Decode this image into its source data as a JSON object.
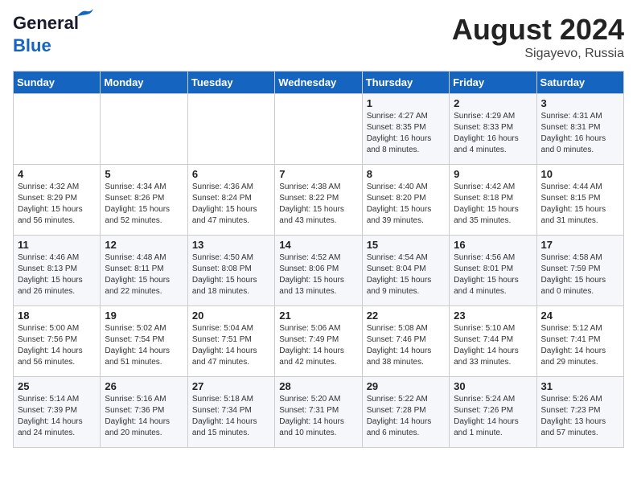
{
  "header": {
    "logo_line1": "General",
    "logo_line2": "Blue",
    "month_year": "August 2024",
    "location": "Sigayevo, Russia"
  },
  "days_of_week": [
    "Sunday",
    "Monday",
    "Tuesday",
    "Wednesday",
    "Thursday",
    "Friday",
    "Saturday"
  ],
  "weeks": [
    [
      {
        "day": "",
        "info": ""
      },
      {
        "day": "",
        "info": ""
      },
      {
        "day": "",
        "info": ""
      },
      {
        "day": "",
        "info": ""
      },
      {
        "day": "1",
        "info": "Sunrise: 4:27 AM\nSunset: 8:35 PM\nDaylight: 16 hours\nand 8 minutes."
      },
      {
        "day": "2",
        "info": "Sunrise: 4:29 AM\nSunset: 8:33 PM\nDaylight: 16 hours\nand 4 minutes."
      },
      {
        "day": "3",
        "info": "Sunrise: 4:31 AM\nSunset: 8:31 PM\nDaylight: 16 hours\nand 0 minutes."
      }
    ],
    [
      {
        "day": "4",
        "info": "Sunrise: 4:32 AM\nSunset: 8:29 PM\nDaylight: 15 hours\nand 56 minutes."
      },
      {
        "day": "5",
        "info": "Sunrise: 4:34 AM\nSunset: 8:26 PM\nDaylight: 15 hours\nand 52 minutes."
      },
      {
        "day": "6",
        "info": "Sunrise: 4:36 AM\nSunset: 8:24 PM\nDaylight: 15 hours\nand 47 minutes."
      },
      {
        "day": "7",
        "info": "Sunrise: 4:38 AM\nSunset: 8:22 PM\nDaylight: 15 hours\nand 43 minutes."
      },
      {
        "day": "8",
        "info": "Sunrise: 4:40 AM\nSunset: 8:20 PM\nDaylight: 15 hours\nand 39 minutes."
      },
      {
        "day": "9",
        "info": "Sunrise: 4:42 AM\nSunset: 8:18 PM\nDaylight: 15 hours\nand 35 minutes."
      },
      {
        "day": "10",
        "info": "Sunrise: 4:44 AM\nSunset: 8:15 PM\nDaylight: 15 hours\nand 31 minutes."
      }
    ],
    [
      {
        "day": "11",
        "info": "Sunrise: 4:46 AM\nSunset: 8:13 PM\nDaylight: 15 hours\nand 26 minutes."
      },
      {
        "day": "12",
        "info": "Sunrise: 4:48 AM\nSunset: 8:11 PM\nDaylight: 15 hours\nand 22 minutes."
      },
      {
        "day": "13",
        "info": "Sunrise: 4:50 AM\nSunset: 8:08 PM\nDaylight: 15 hours\nand 18 minutes."
      },
      {
        "day": "14",
        "info": "Sunrise: 4:52 AM\nSunset: 8:06 PM\nDaylight: 15 hours\nand 13 minutes."
      },
      {
        "day": "15",
        "info": "Sunrise: 4:54 AM\nSunset: 8:04 PM\nDaylight: 15 hours\nand 9 minutes."
      },
      {
        "day": "16",
        "info": "Sunrise: 4:56 AM\nSunset: 8:01 PM\nDaylight: 15 hours\nand 4 minutes."
      },
      {
        "day": "17",
        "info": "Sunrise: 4:58 AM\nSunset: 7:59 PM\nDaylight: 15 hours\nand 0 minutes."
      }
    ],
    [
      {
        "day": "18",
        "info": "Sunrise: 5:00 AM\nSunset: 7:56 PM\nDaylight: 14 hours\nand 56 minutes."
      },
      {
        "day": "19",
        "info": "Sunrise: 5:02 AM\nSunset: 7:54 PM\nDaylight: 14 hours\nand 51 minutes."
      },
      {
        "day": "20",
        "info": "Sunrise: 5:04 AM\nSunset: 7:51 PM\nDaylight: 14 hours\nand 47 minutes."
      },
      {
        "day": "21",
        "info": "Sunrise: 5:06 AM\nSunset: 7:49 PM\nDaylight: 14 hours\nand 42 minutes."
      },
      {
        "day": "22",
        "info": "Sunrise: 5:08 AM\nSunset: 7:46 PM\nDaylight: 14 hours\nand 38 minutes."
      },
      {
        "day": "23",
        "info": "Sunrise: 5:10 AM\nSunset: 7:44 PM\nDaylight: 14 hours\nand 33 minutes."
      },
      {
        "day": "24",
        "info": "Sunrise: 5:12 AM\nSunset: 7:41 PM\nDaylight: 14 hours\nand 29 minutes."
      }
    ],
    [
      {
        "day": "25",
        "info": "Sunrise: 5:14 AM\nSunset: 7:39 PM\nDaylight: 14 hours\nand 24 minutes."
      },
      {
        "day": "26",
        "info": "Sunrise: 5:16 AM\nSunset: 7:36 PM\nDaylight: 14 hours\nand 20 minutes."
      },
      {
        "day": "27",
        "info": "Sunrise: 5:18 AM\nSunset: 7:34 PM\nDaylight: 14 hours\nand 15 minutes."
      },
      {
        "day": "28",
        "info": "Sunrise: 5:20 AM\nSunset: 7:31 PM\nDaylight: 14 hours\nand 10 minutes."
      },
      {
        "day": "29",
        "info": "Sunrise: 5:22 AM\nSunset: 7:28 PM\nDaylight: 14 hours\nand 6 minutes."
      },
      {
        "day": "30",
        "info": "Sunrise: 5:24 AM\nSunset: 7:26 PM\nDaylight: 14 hours\nand 1 minute."
      },
      {
        "day": "31",
        "info": "Sunrise: 5:26 AM\nSunset: 7:23 PM\nDaylight: 13 hours\nand 57 minutes."
      }
    ]
  ]
}
